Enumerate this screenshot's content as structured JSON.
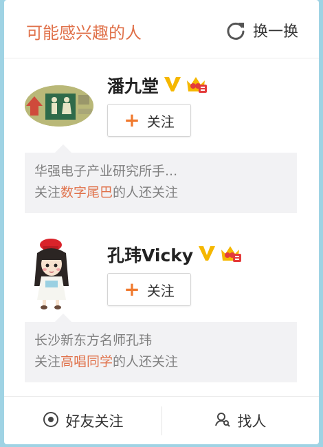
{
  "header": {
    "title": "可能感兴趣的人",
    "refresh_label": "换一换"
  },
  "colors": {
    "accent": "#e0714a",
    "vip_gold": "#f5b700",
    "follow_plus": "#f07a2f"
  },
  "suggestions": [
    {
      "name": "潘九堂",
      "follow_label": "关注",
      "bio": "华强电子产业研究所手...",
      "reason_prefix": "关注",
      "reason_link": "数字尾巴",
      "reason_suffix": "的人还关注"
    },
    {
      "name": "孔玮Vicky",
      "follow_label": "关注",
      "bio": "长沙新东方名师孔玮",
      "reason_prefix": "关注",
      "reason_link": "高唱同学",
      "reason_suffix": "的人还关注"
    }
  ],
  "footer": {
    "friends_follow_label": "好友关注",
    "find_people_label": "找人"
  }
}
